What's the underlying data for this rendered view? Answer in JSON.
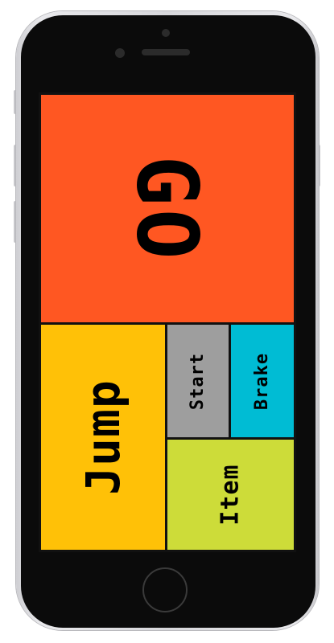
{
  "device": {
    "frame": "phone"
  },
  "controls": {
    "go": {
      "label": "GO",
      "color": "#FF5722"
    },
    "jump": {
      "label": "Jump",
      "color": "#FFC107"
    },
    "start": {
      "label": "Start",
      "color": "#9E9E9E"
    },
    "brake": {
      "label": "Brake",
      "color": "#00BCD4"
    },
    "item": {
      "label": "Item",
      "color": "#CDDC39"
    }
  },
  "icons": {
    "camera": "camera-icon",
    "speaker": "speaker-icon",
    "home": "home-button-icon"
  }
}
